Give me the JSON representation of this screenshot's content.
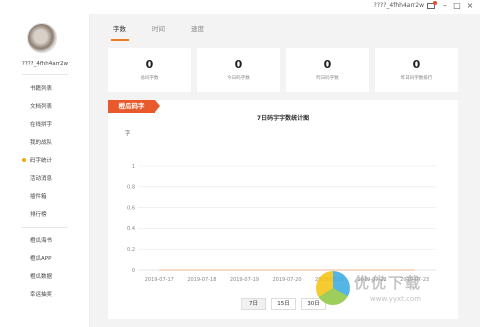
{
  "titlebar": {
    "username": "????_4fhh4arr2w",
    "minimize": "–",
    "maximize": "□",
    "close": "×"
  },
  "sidebar": {
    "username": "????_4fhh4arr2w",
    "items": [
      {
        "label": "书籍列表"
      },
      {
        "label": "文档列表"
      },
      {
        "label": "在线拼字"
      },
      {
        "label": "我的战队"
      },
      {
        "label": "码字统计",
        "active": true
      },
      {
        "label": "活动消息"
      },
      {
        "label": "插件箱"
      },
      {
        "label": "排行榜"
      },
      {
        "label": "橙瓜海书"
      },
      {
        "label": "橙瓜APP"
      },
      {
        "label": "橙瓜数据"
      },
      {
        "label": "幸运抽奖"
      }
    ]
  },
  "tabs": [
    {
      "label": "字数",
      "active": true
    },
    {
      "label": "时间"
    },
    {
      "label": "速度"
    }
  ],
  "stats": [
    {
      "value": "0",
      "label": "总码字数"
    },
    {
      "value": "0",
      "label": "今日码字数"
    },
    {
      "value": "0",
      "label": "昨日码字数"
    },
    {
      "value": "0",
      "label": "昨日码字数排行"
    }
  ],
  "ribbon_label": "橙瓜码字",
  "chart_data": {
    "type": "line",
    "title": "7日码字字数统计图",
    "ylabel": "字",
    "xlabel": "",
    "categories": [
      "2019-07-17",
      "2019-07-18",
      "2019-07-19",
      "2019-07-20",
      "2019-07-21",
      "2019-07-22",
      "2019-07-23"
    ],
    "y_ticks": [
      "0",
      "0.2",
      "0.4",
      "0.6",
      "0.8",
      "1"
    ],
    "ylim": [
      0,
      1
    ],
    "series": [
      {
        "values": [
          0,
          0,
          0,
          0,
          0,
          0,
          0
        ]
      }
    ],
    "grid": true
  },
  "range_buttons": [
    {
      "label": "7日",
      "active": true
    },
    {
      "label": "15日"
    },
    {
      "label": "30日"
    }
  ],
  "watermark": {
    "text": "优优下载",
    "url": "www.yyxt.com"
  }
}
